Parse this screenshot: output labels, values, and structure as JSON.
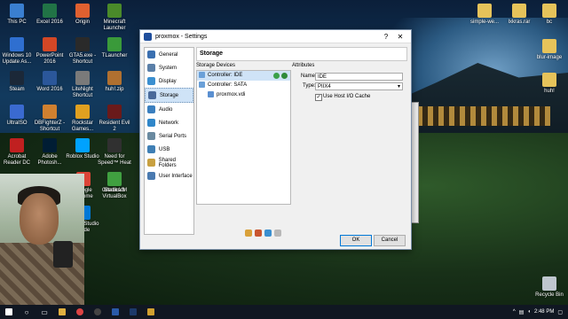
{
  "window": {
    "title": "proxmox - Settings",
    "help": "?",
    "close": "✕"
  },
  "sidebar": {
    "items": [
      {
        "label": "General",
        "color": "#3a6fb0"
      },
      {
        "label": "System",
        "color": "#5a7fa8"
      },
      {
        "label": "Display",
        "color": "#3a8fd0"
      },
      {
        "label": "Storage",
        "color": "#4a6a9a"
      },
      {
        "label": "Audio",
        "color": "#3a7fbf"
      },
      {
        "label": "Network",
        "color": "#2f86c9"
      },
      {
        "label": "Serial Ports",
        "color": "#6a8aa0"
      },
      {
        "label": "USB",
        "color": "#3f7fb5"
      },
      {
        "label": "Shared Folders",
        "color": "#c8a040"
      },
      {
        "label": "User Interface",
        "color": "#4a7ab0"
      }
    ]
  },
  "storage": {
    "section_title": "Storage",
    "devices_label": "Storage Devices",
    "tree": [
      {
        "label": "Controller: IDE",
        "level": 0
      },
      {
        "label": "Controller: SATA",
        "level": 0
      },
      {
        "label": "proxmox.vdi",
        "level": 1
      }
    ]
  },
  "attributes": {
    "title": "Attributes",
    "name_label": "Name:",
    "name_value": "IDE",
    "type_label": "Type:",
    "type_value": "PIIX4",
    "host_io_label": "Use Host I/O Cache",
    "host_io_checked": true
  },
  "buttons": {
    "ok": "OK",
    "cancel": "Cancel"
  },
  "desktop": {
    "left_icons": [
      "This PC",
      "Excel 2016",
      "Origin",
      "Minecraft Launcher",
      "Windows 10 Update As...",
      "PowerPoint 2016",
      "GTA5.exe - Shortcut",
      "TLauncher",
      "Steam",
      "Word 2016",
      "LiteNight Shortcut",
      "huh!.zip",
      "UltraISO",
      "DBFighterZ - Shortcut",
      "Rockstar Games...",
      "Resident Evil 2",
      "Acrobat Reader DC",
      "Adobe Photosh...",
      "Roblox Studio",
      "Need for Speed™ Heat",
      "Google Chrome",
      "Oracle VM VirtualBox",
      "Medicam",
      "Stacks 3",
      "Visual Studio Code"
    ],
    "right_icons": [
      "simple-we...",
      "lxkras.rar",
      "bc",
      "blur-image",
      "huh!",
      "Recycle Bin"
    ]
  },
  "taskbar": {
    "time": "2:48 PM",
    "icons": [
      "start-icon",
      "search-icon",
      "task-view-icon",
      "explorer-icon",
      "chrome-icon",
      "obs-icon",
      "virtualbox-icon",
      "photoshop-icon",
      "explorer2-icon"
    ]
  }
}
